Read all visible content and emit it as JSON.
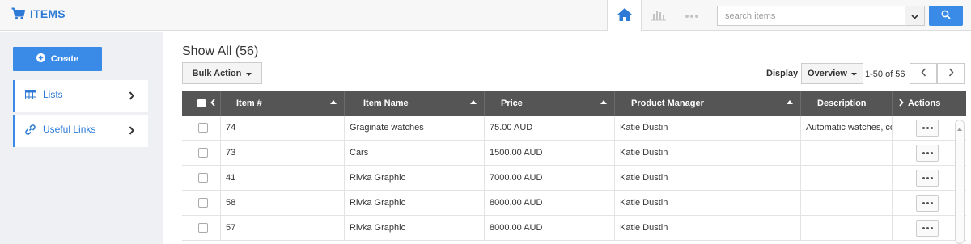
{
  "app": {
    "title": "ITEMS",
    "brand_color": "#2d7bd6",
    "accent_color": "#3a8be8"
  },
  "topbar": {
    "icons": [
      "home-icon",
      "bar-chart-icon",
      "more-dots-icon"
    ],
    "search": {
      "placeholder": "search items",
      "value": ""
    }
  },
  "sidebar": {
    "create_label": "Create",
    "items": [
      {
        "label": "Lists",
        "icon": "table-icon"
      },
      {
        "label": "Useful Links",
        "icon": "link-icon"
      }
    ]
  },
  "main": {
    "title": "Show All (56)",
    "bulk_action_label": "Bulk Action",
    "display_label": "Display",
    "display_value": "Overview",
    "range_text": "1-50 of 56"
  },
  "table": {
    "columns": [
      {
        "label": ""
      },
      {
        "label": "Item #"
      },
      {
        "label": "Item Name"
      },
      {
        "label": "Price"
      },
      {
        "label": "Product Manager"
      },
      {
        "label": "Description"
      },
      {
        "label": "Actions"
      }
    ],
    "rows": [
      {
        "item": "74",
        "name": "Graginate watches",
        "price": "75.00 AUD",
        "manager": "Katie Dustin",
        "description": "Automatic watches, cor"
      },
      {
        "item": "73",
        "name": "Cars",
        "price": "1500.00 AUD",
        "manager": "Katie Dustin",
        "description": ""
      },
      {
        "item": "41",
        "name": "Rivka Graphic",
        "price": "7000.00 AUD",
        "manager": "Katie Dustin",
        "description": ""
      },
      {
        "item": "58",
        "name": "Rivka Graphic",
        "price": "8000.00 AUD",
        "manager": "Katie Dustin",
        "description": ""
      },
      {
        "item": "57",
        "name": "Rivka Graphic",
        "price": "8000.00 AUD",
        "manager": "Katie Dustin",
        "description": ""
      }
    ]
  }
}
